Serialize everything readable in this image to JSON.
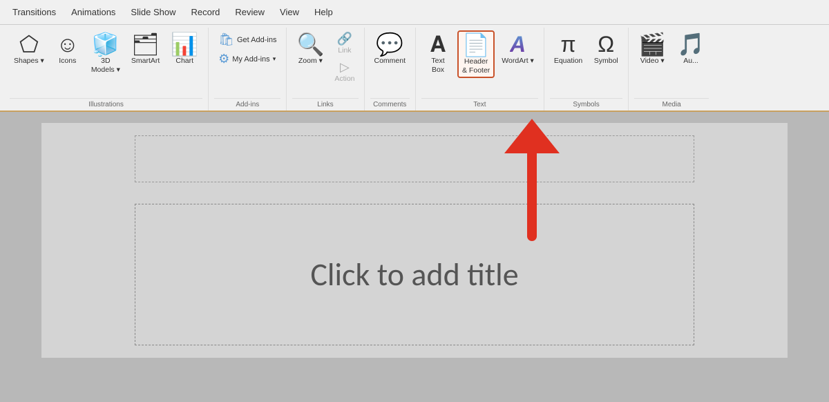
{
  "menu": {
    "items": [
      "Transitions",
      "Animations",
      "Slide Show",
      "Record",
      "Review",
      "View",
      "Help"
    ]
  },
  "ribbon": {
    "groups": [
      {
        "name": "Illustrations",
        "label": "Illustrations",
        "buttons": [
          {
            "id": "shapes",
            "icon": "shapes",
            "label": "Shapes",
            "large": true,
            "has_arrow": true
          },
          {
            "id": "icons",
            "icon": "icons",
            "label": "Icons",
            "large": true
          },
          {
            "id": "3d-models",
            "icon": "3d-models",
            "label": "3D\nModels",
            "large": true,
            "has_arrow": true
          },
          {
            "id": "smartart",
            "icon": "smartart",
            "label": "SmartArt",
            "large": true
          },
          {
            "id": "chart",
            "icon": "chart",
            "label": "Chart",
            "large": true
          }
        ]
      },
      {
        "name": "Add-ins",
        "label": "Add-ins",
        "buttons_sm": [
          {
            "id": "get-addins",
            "label": "Get Add-ins"
          },
          {
            "id": "my-addins",
            "label": "My Add-ins",
            "has_arrow": true
          }
        ]
      },
      {
        "name": "Links",
        "label": "Links",
        "buttons": [
          {
            "id": "zoom",
            "icon": "zoom",
            "label": "Zoom",
            "large": true,
            "has_arrow": true
          },
          {
            "id": "link",
            "icon": "link",
            "label": "Link",
            "large": false,
            "disabled": true
          },
          {
            "id": "action",
            "icon": "action",
            "label": "Action",
            "large": false,
            "disabled": true
          }
        ]
      },
      {
        "name": "Comments",
        "label": "Comments",
        "buttons": [
          {
            "id": "comment",
            "icon": "comment",
            "label": "Comment",
            "large": true
          }
        ]
      },
      {
        "name": "Text",
        "label": "Text",
        "buttons": [
          {
            "id": "text-box",
            "icon": "textbox",
            "label": "Text\nBox",
            "large": true
          },
          {
            "id": "header-footer",
            "icon": "header-footer",
            "label": "Header\n& Footer",
            "large": true,
            "highlighted": true
          },
          {
            "id": "wordart",
            "icon": "wordart",
            "label": "WordArt",
            "large": true,
            "has_arrow": true
          }
        ]
      },
      {
        "name": "Symbols",
        "label": "Symbols",
        "buttons": [
          {
            "id": "equation",
            "icon": "equation",
            "label": "Equation",
            "large": true
          },
          {
            "id": "symbol",
            "icon": "symbol",
            "label": "Symbol",
            "large": true
          }
        ]
      },
      {
        "name": "Media",
        "label": "Media",
        "buttons": [
          {
            "id": "video",
            "icon": "video",
            "label": "Video",
            "large": true,
            "has_arrow": true
          },
          {
            "id": "audio",
            "icon": "audio",
            "label": "Au...",
            "large": true
          }
        ]
      }
    ]
  },
  "slide": {
    "title_placeholder": "Click to add title"
  },
  "labels": {
    "get_addins": "Get Add-ins",
    "my_addins": "My Add-ins"
  }
}
